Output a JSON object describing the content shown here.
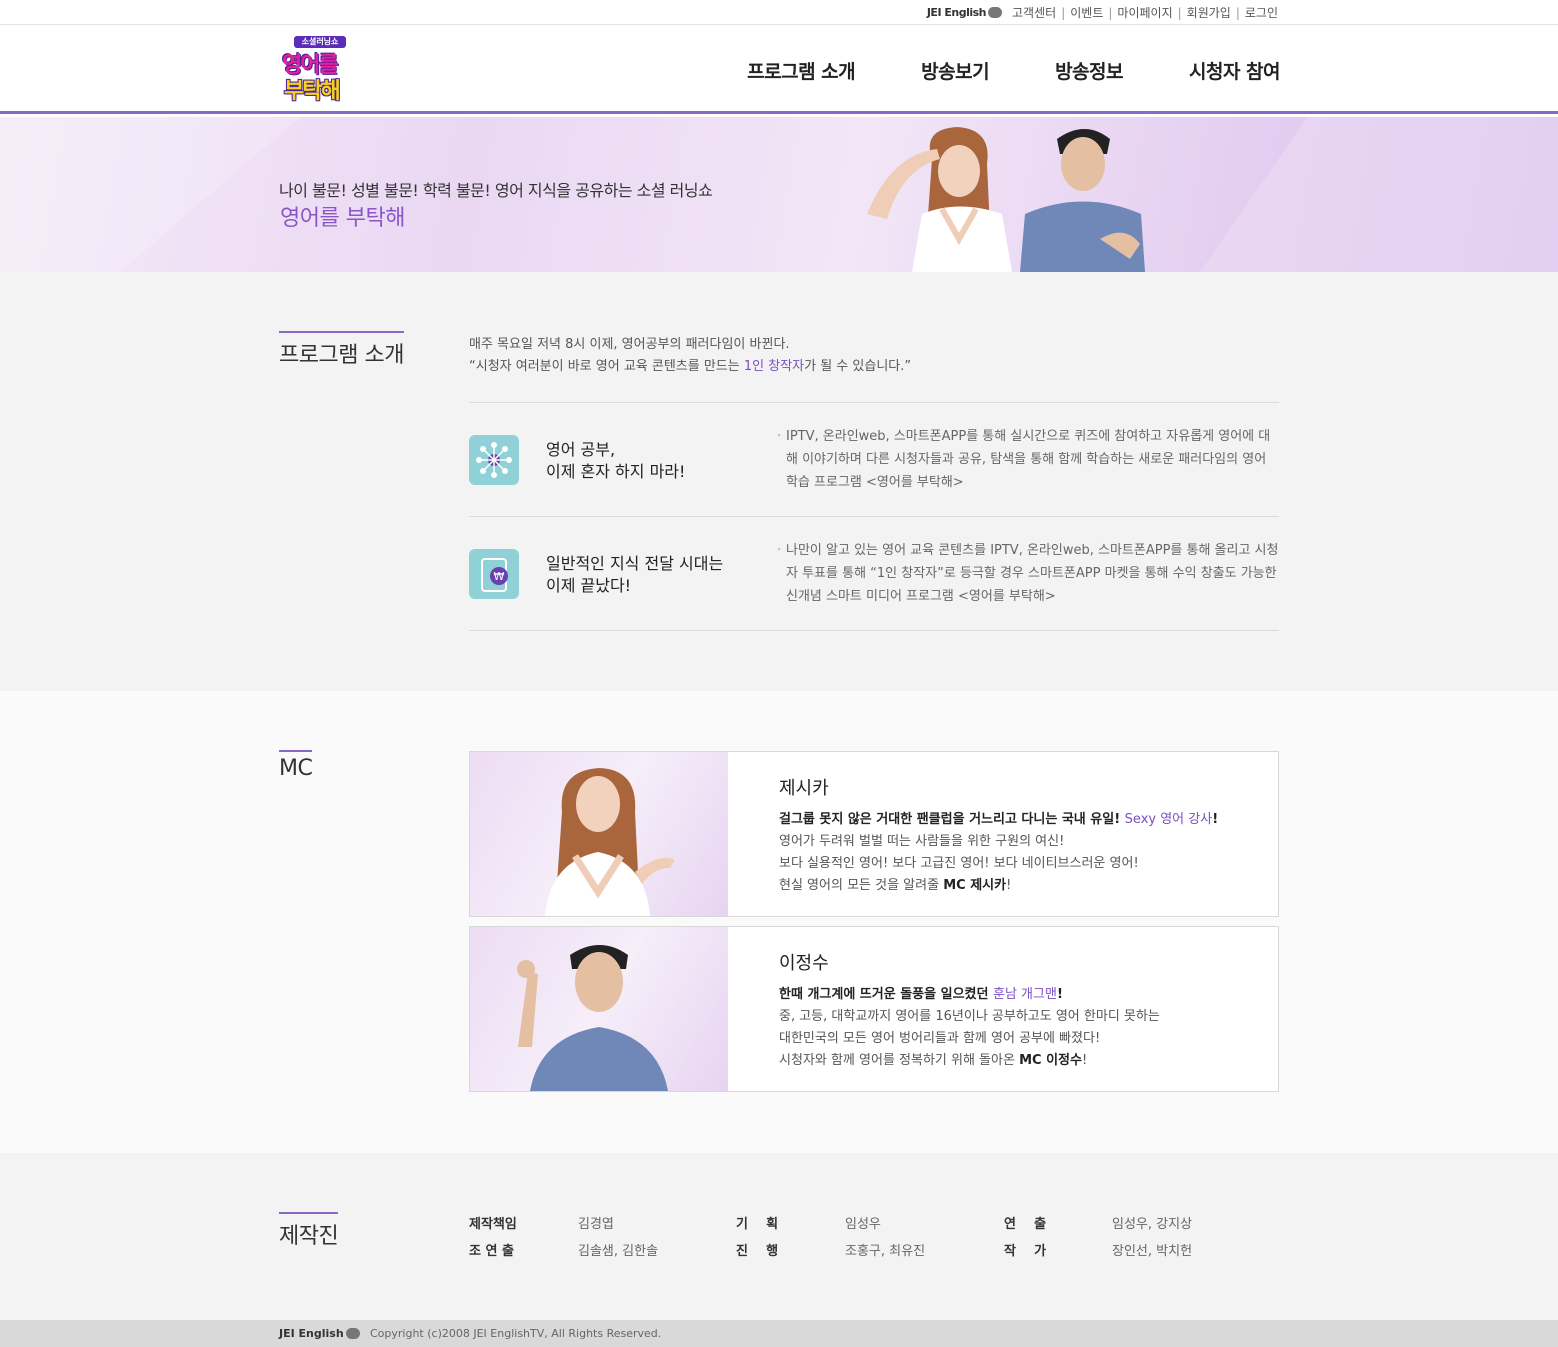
{
  "util": {
    "brand": "JEI English",
    "links": [
      "고객센터",
      "이벤트",
      "마이페이지",
      "회원가입",
      "로그인"
    ]
  },
  "header": {
    "logo_tag": "소셜러닝쇼",
    "logo_line1": "영어를",
    "logo_line2": "부탁해",
    "nav": [
      "프로그램 소개",
      "방송보기",
      "방송정보",
      "시청자 참여"
    ]
  },
  "banner": {
    "subtitle": "나이 불문! 성별 불문! 학력 불문! 영어 지식을 공유하는 소셜 러닝쇼",
    "title": "영어를 부탁해"
  },
  "program": {
    "heading": "프로그램 소개",
    "intro1": "매주 목요일 저녁 8시 이제, 영어공부의 패러다임이 바뀐다.",
    "intro2_pre": "“시청자 여러분이 바로 영어 교육 콘텐츠를 만드는 ",
    "intro2_hl": "1인 창작자",
    "intro2_post": "가 될 수 있습니다.”",
    "features": [
      {
        "icon": "network-icon",
        "title1": "영어 공부,",
        "title2": "이제 혼자 하지 마라!",
        "desc": "IPTV, 온라인web, 스마트폰APP를 통해 실시간으로 퀴즈에 참여하고 자유롭게 영어에 대해 이야기하며 다른 시청자들과 공유, 탐색을 통해 함께 학습하는 새로운 패러다임의 영어 학습 프로그램 <영어를 부탁해>"
      },
      {
        "icon": "tablet-won-icon",
        "title1": "일반적인 지식 전달 시대는",
        "title2": "이제 끝났다!",
        "desc": "나만이 알고 있는 영어 교육 콘텐츠를 IPTV, 온라인web, 스마트폰APP를 통해 올리고 시청자 투표를 통해 “1인 창작자”로 등극할 경우 스마트폰APP 마켓을 통해 수익 창출도 가능한 신개념 스마트 미디어 프로그램 <영어를 부탁해>"
      }
    ]
  },
  "mc": {
    "heading": "MC",
    "cards": [
      {
        "name": "제시카",
        "line1_pre": "걸그룹 못지 않은 거대한 팬클럽을 거느리고 다니는 국내 유일! ",
        "line1_hl": "Sexy 영어 강사",
        "line1_post": "!",
        "line2": "영어가 두려워 벌벌 떠는 사람들을 위한 구원의 여신!",
        "line3": "보다 실용적인 영어! 보다 고급진 영어! 보다 네이티브스러운 영어!",
        "line4_pre": "현실 영어의 모든 것을 알려줄 ",
        "line4_b": "MC 제시카",
        "line4_post": "!"
      },
      {
        "name": "이정수",
        "line1_pre": "한때 개그계에 뜨거운 돌풍을 일으켰던 ",
        "line1_hl": "훈남 개그맨",
        "line1_post": "!",
        "line2": "중, 고등, 대학교까지 영어를 16년이나 공부하고도 영어 한마디 못하는",
        "line3": "대한민국의 모든 영어 벙어리들과 함께 영어 공부에 빠졌다!",
        "line4_pre": "시청자와 함께 영어를 정복하기 위해 돌아온 ",
        "line4_b": "MC 이정수",
        "line4_post": "!"
      }
    ]
  },
  "staff": {
    "heading": "제작진",
    "rows": [
      [
        {
          "k": "제작책임",
          "v": "김경엽"
        },
        {
          "k": "기    획",
          "v": "임성우"
        },
        {
          "k": "연    출",
          "v": "임성우, 강지상"
        }
      ],
      [
        {
          "k": "조 연 출",
          "v": "김솔샘, 김한솔"
        },
        {
          "k": "진    행",
          "v": "조홍구, 최유진"
        },
        {
          "k": "작    가",
          "v": "장인선, 박치헌"
        }
      ]
    ]
  },
  "footer": {
    "brand": "JEI English",
    "copyright": "Copyright (c)2008 JEI EnglishTV, All Rights Reserved."
  },
  "colors": {
    "accent": "#8a68c7",
    "highlight": "#7c4fc3",
    "icon_bg": "#8fd1d6"
  }
}
